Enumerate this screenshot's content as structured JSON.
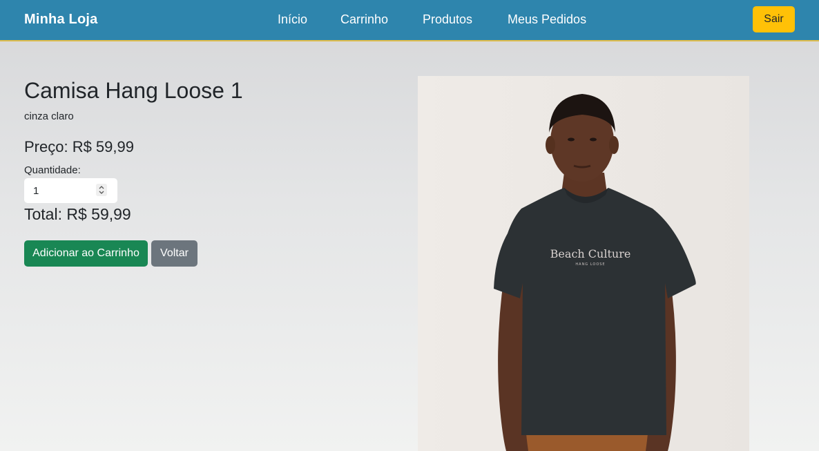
{
  "navbar": {
    "brand": "Minha Loja",
    "links": [
      "Início",
      "Carrinho",
      "Produtos",
      "Meus Pedidos"
    ],
    "logout_label": "Sair"
  },
  "product": {
    "title": "Camisa Hang Loose 1",
    "description": "cinza claro",
    "price_text": "Preço: R$ 59,99",
    "quantity_label": "Quantidade:",
    "quantity_value": "1",
    "total_text": "Total: R$ 59,99",
    "image_print_text": "Beach Culture",
    "image_print_subtext": "HANG LOOSE"
  },
  "actions": {
    "add_to_cart_label": "Adicionar ao Carrinho",
    "back_label": "Voltar"
  },
  "colors": {
    "navbar_bg": "#2e85ad",
    "logout_button": "#ffc107",
    "add_button": "#198754",
    "back_button": "#6c757d"
  },
  "icons": {
    "quantity_spinner": "spinner-arrows-icon"
  }
}
